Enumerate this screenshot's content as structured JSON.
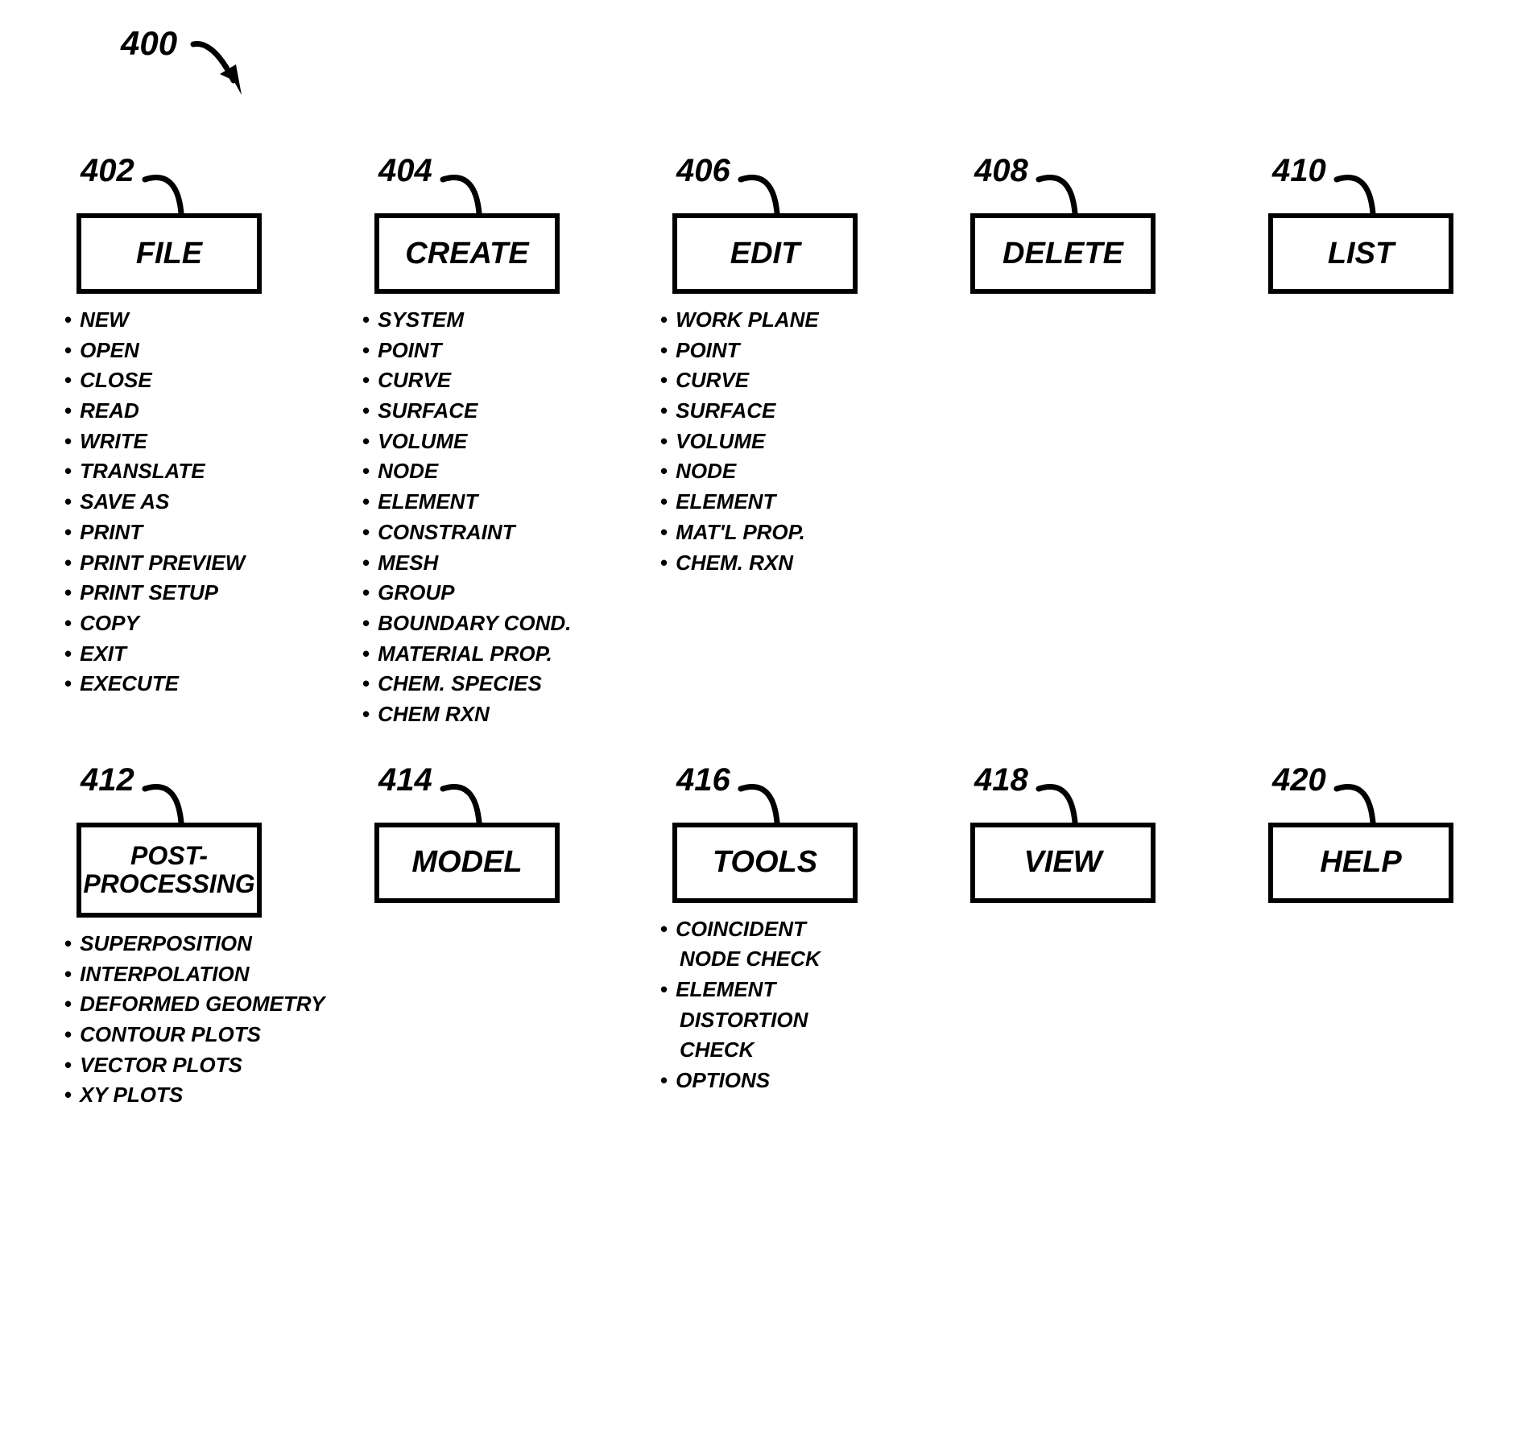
{
  "diagram": {
    "mainRef": "400",
    "menus": [
      {
        "ref": "402",
        "title": "FILE",
        "items": [
          "NEW",
          "OPEN",
          "CLOSE",
          "READ",
          "WRITE",
          "TRANSLATE",
          "SAVE AS",
          "PRINT",
          "PRINT PREVIEW",
          "PRINT SETUP",
          "COPY",
          "EXIT",
          "EXECUTE"
        ]
      },
      {
        "ref": "404",
        "title": "CREATE",
        "items": [
          "SYSTEM",
          "POINT",
          "CURVE",
          "SURFACE",
          "VOLUME",
          "NODE",
          "ELEMENT",
          "CONSTRAINT",
          "MESH",
          "GROUP",
          "BOUNDARY COND.",
          "MATERIAL PROP.",
          "CHEM. SPECIES",
          "CHEM RXN"
        ]
      },
      {
        "ref": "406",
        "title": "EDIT",
        "items": [
          "WORK PLANE",
          "POINT",
          "CURVE",
          "SURFACE",
          "VOLUME",
          "NODE",
          "ELEMENT",
          "MAT'L PROP.",
          "CHEM. RXN"
        ]
      },
      {
        "ref": "408",
        "title": "DELETE",
        "items": []
      },
      {
        "ref": "410",
        "title": "LIST",
        "items": []
      },
      {
        "ref": "412",
        "title": "POST-\nPROCESSING",
        "twolines": true,
        "items": [
          "SUPERPOSITION",
          "INTERPOLATION",
          "DEFORMED GEOMETRY",
          "CONTOUR PLOTS",
          "VECTOR PLOTS",
          "XY PLOTS"
        ]
      },
      {
        "ref": "414",
        "title": "MODEL",
        "items": []
      },
      {
        "ref": "416",
        "title": "TOOLS",
        "items": [
          "COINCIDENT NODE CHECK",
          "ELEMENT DISTORTION CHECK",
          "OPTIONS"
        ],
        "wrapItems": [
          0,
          1
        ]
      },
      {
        "ref": "418",
        "title": "VIEW",
        "items": []
      },
      {
        "ref": "420",
        "title": "HELP",
        "items": []
      }
    ]
  }
}
